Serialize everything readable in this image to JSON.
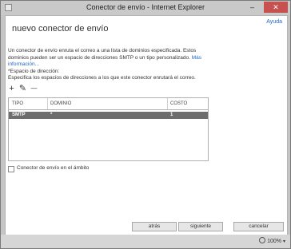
{
  "window": {
    "title": "Conector de envío - Internet Explorer",
    "minimize_glyph": "–",
    "close_glyph": "✕"
  },
  "help": "Ayuda",
  "page_title": "nuevo conector de envío",
  "description": {
    "text": "Un conector de envío enruta el correo a una lista de dominios especificada. Estos dominios pueden ser un espacio de direcciones SMTP o un tipo personalizado. ",
    "link": "Más información..."
  },
  "address_space": {
    "label": "*Espacio de dirección:",
    "help": "Especifica los espacios de direcciones a los que este conector enrutará el correo.",
    "toolbar": {
      "add_glyph": "+",
      "edit_glyph": "✎",
      "remove_glyph": "—"
    },
    "columns": [
      "TIPO",
      "DOMINIO",
      "COSTO"
    ],
    "rows": [
      {
        "type": "SMTP",
        "domain": "*",
        "cost": "1"
      }
    ]
  },
  "scope": {
    "label": "Conector de envío en el ámbito",
    "checked": false
  },
  "buttons": {
    "back": "atrás",
    "next": "siguiente",
    "cancel": "cancelar"
  },
  "status": {
    "zoom": "100%",
    "caret": "▾"
  }
}
